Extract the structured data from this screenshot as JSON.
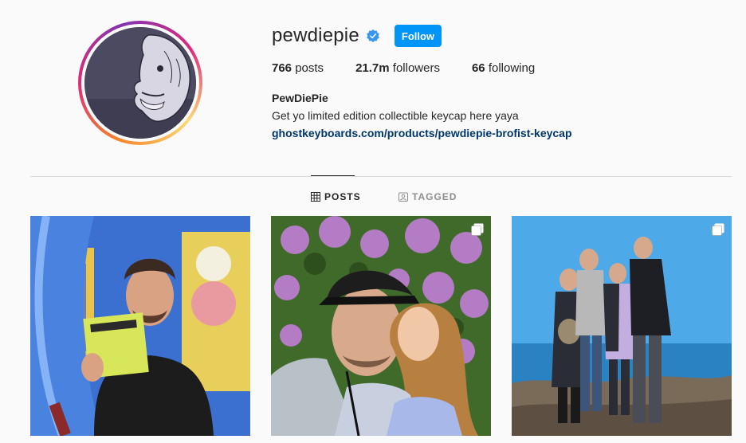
{
  "profile": {
    "username": "pewdiepie",
    "follow_label": "Follow",
    "stats": {
      "posts_count": "766",
      "posts_label": "posts",
      "followers_count": "21.7m",
      "followers_label": "followers",
      "following_count": "66",
      "following_label": "following"
    },
    "full_name": "PewDiePie",
    "bio": "Get yo limited edition collectible keycap here yaya",
    "link": "ghostkeyboards.com/products/pewdiepie-brofist-keycap"
  },
  "tabs": [
    {
      "label": "POSTS",
      "icon": "grid-icon",
      "active": true
    },
    {
      "label": "TAGGED",
      "icon": "tagged-icon",
      "active": false
    }
  ],
  "posts": [
    {
      "index": 1,
      "multi": false
    },
    {
      "index": 2,
      "multi": true
    },
    {
      "index": 3,
      "multi": true
    }
  ],
  "colors": {
    "follow_button": "#0095f6",
    "link": "#00376b",
    "verified": "#3897f0"
  }
}
